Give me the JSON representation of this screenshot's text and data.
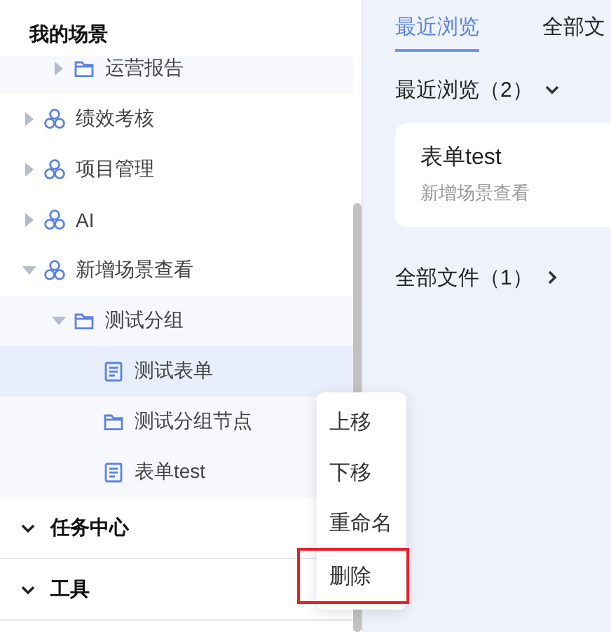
{
  "sidebar": {
    "title": "我的场景",
    "tree": [
      {
        "children": [
          {
            "label": "运营报告",
            "kind": "folder",
            "expanded": false,
            "selected": false
          }
        ]
      },
      {
        "label": "绩效考核",
        "kind": "scene",
        "expanded": false,
        "selected": false
      },
      {
        "label": "项目管理",
        "kind": "scene",
        "expanded": false,
        "selected": false
      },
      {
        "label": "AI",
        "kind": "scene",
        "expanded": false,
        "selected": false
      },
      {
        "label": "新增场景查看",
        "kind": "scene",
        "expanded": true,
        "selected": false,
        "children": [
          {
            "label": "测试分组",
            "kind": "folder",
            "expanded": true,
            "selected": false,
            "children": [
              {
                "label": "测试表单",
                "kind": "form",
                "selected": true
              },
              {
                "label": "测试分组节点",
                "kind": "folder",
                "selected": false
              },
              {
                "label": "表单test",
                "kind": "form",
                "selected": false
              }
            ]
          }
        ]
      }
    ],
    "sections": [
      {
        "label": "任务中心",
        "expanded": true
      },
      {
        "label": "工具",
        "expanded": true
      }
    ]
  },
  "context_menu": {
    "items": [
      {
        "label": "上移",
        "selected": false
      },
      {
        "label": "下移",
        "selected": false
      },
      {
        "label": "重命名",
        "selected": false
      },
      {
        "label": "删除",
        "selected": true
      }
    ]
  },
  "main": {
    "tabs": [
      {
        "label": "最近浏览",
        "selected": true
      },
      {
        "label": "全部文",
        "selected": false
      }
    ],
    "recent": {
      "heading": "最近浏览（2）",
      "expanded": true,
      "cards": [
        {
          "title": "表单test",
          "subtitle": "新增场景查看"
        }
      ]
    },
    "all_files": {
      "heading": "全部文件（1）",
      "expanded": false
    }
  }
}
